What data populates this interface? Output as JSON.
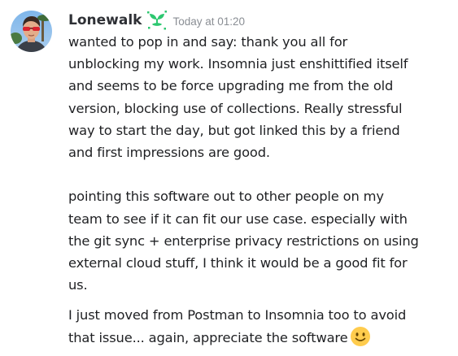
{
  "author": {
    "name": "Lonewalk",
    "timestamp": "Today at 01:20"
  },
  "icons": {
    "avatar": "user-avatar-photo",
    "badge": "green-sprout-badge-icon",
    "emoji": "slightly-smiling-face-emoji"
  },
  "colors": {
    "badge_green": "#2dc770",
    "timestamp_gray": "#8a8e94",
    "text": "#1f2023",
    "emoji_yellow": "#ffcc4d"
  },
  "messages": [
    {
      "paragraphs": [
        {
          "lines": [
            "wanted to pop in and say: thank you all for",
            "unblocking my work. Insomnia just enshittified itself",
            "and seems to be force upgrading me from the old",
            "version, blocking use of collections. Really stressful",
            "way to start the day, but got linked this by a friend",
            "and first impressions are good."
          ]
        },
        {
          "lines": [
            "pointing this software out to other people on my",
            "team to see if it can fit our use case. especially with",
            "the git sync + enterprise privacy restrictions on using",
            "external cloud stuff, I think it would be a good fit for",
            "us."
          ]
        }
      ]
    },
    {
      "paragraphs": [
        {
          "lines": [
            "I just moved from Postman to Insomnia too to avoid",
            "that issue... again, appreciate the software"
          ]
        }
      ]
    }
  ]
}
